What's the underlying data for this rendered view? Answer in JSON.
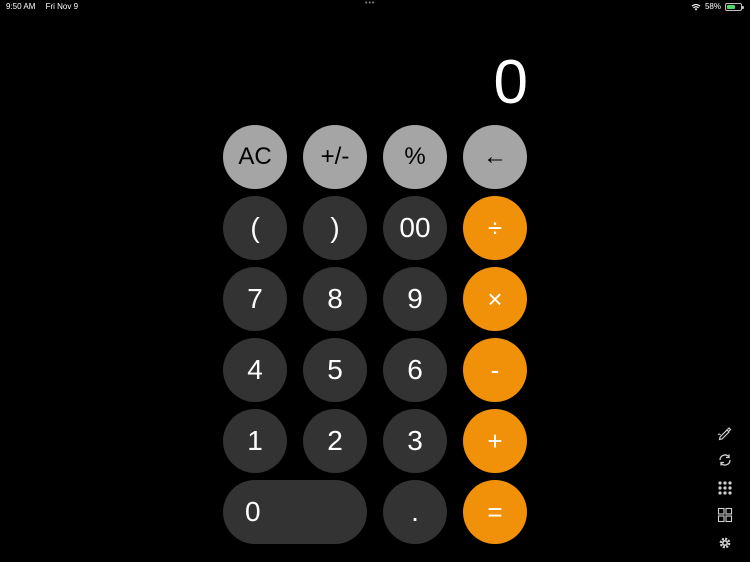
{
  "status": {
    "time": "9:50 AM",
    "date": "Fri Nov 9",
    "battery_pct": "58%",
    "battery_level": 0.58
  },
  "display": {
    "value": "0"
  },
  "keys": {
    "ac": "AC",
    "plusminus": "+/-",
    "percent": "%",
    "backspace": "←",
    "paren_open": "(",
    "paren_close": ")",
    "double_zero": "00",
    "divide": "÷",
    "seven": "7",
    "eight": "8",
    "nine": "9",
    "multiply": "×",
    "four": "4",
    "five": "5",
    "six": "6",
    "minus": "-",
    "one": "1",
    "two": "2",
    "three": "3",
    "plus": "+",
    "zero": "0",
    "decimal": ".",
    "equals": "="
  },
  "colors": {
    "function_key": "#a5a5a5",
    "number_key": "#333333",
    "operator_key": "#f1910a",
    "background": "#000000"
  },
  "sidebar_tools": [
    "pen-icon",
    "rotate-icon",
    "keypad-grid-icon",
    "layout-icon",
    "gear-icon"
  ]
}
